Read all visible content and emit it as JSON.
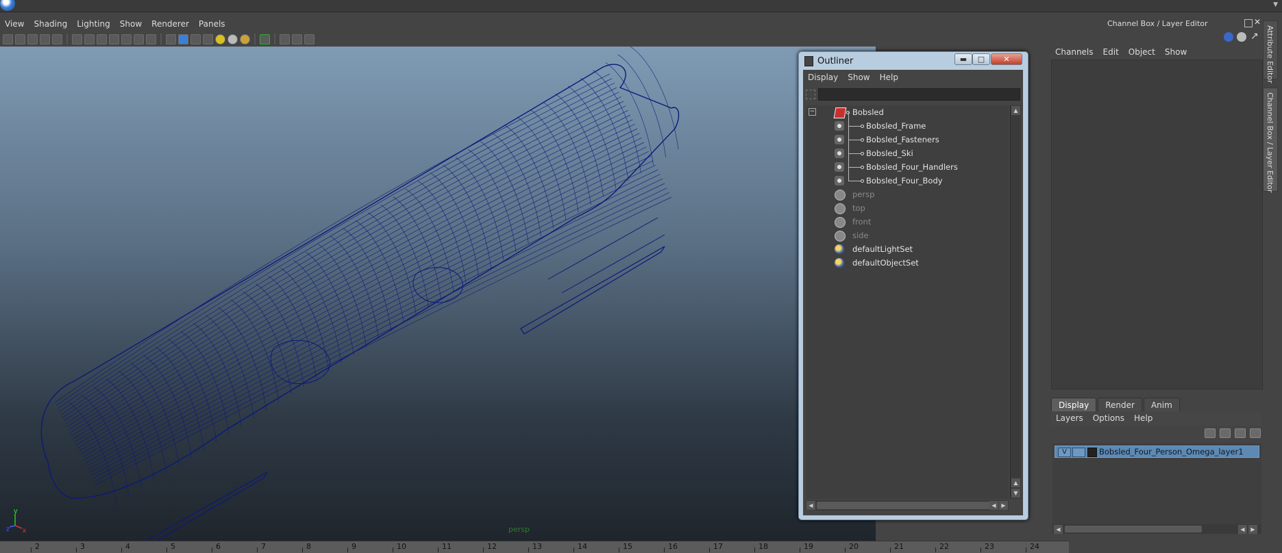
{
  "menubar": {
    "items": [
      "View",
      "Shading",
      "Lighting",
      "Show",
      "Renderer",
      "Panels"
    ]
  },
  "viewport": {
    "camera_label": "persp",
    "wireframe_color": "#0a1a7a",
    "axis": {
      "y": "y",
      "x": "x",
      "z": "z"
    }
  },
  "timeline": {
    "ticks": [
      "2",
      "3",
      "4",
      "5",
      "6",
      "7",
      "8",
      "9",
      "10",
      "11",
      "12",
      "13",
      "14",
      "15",
      "16",
      "17",
      "18",
      "19",
      "20",
      "21",
      "22",
      "23",
      "24"
    ]
  },
  "outliner": {
    "title": "Outliner",
    "buttons": {
      "minimize": "▬",
      "maximize": "□",
      "close": "✕"
    },
    "menu": [
      "Display",
      "Show",
      "Help"
    ],
    "filter_value": "",
    "tree": [
      {
        "label": "Bobsled",
        "kind": "group",
        "icon": "set-icon"
      },
      {
        "label": "Bobsled_Frame",
        "kind": "mesh",
        "icon": "mesh-icon"
      },
      {
        "label": "Bobsled_Fasteners",
        "kind": "mesh",
        "icon": "mesh-icon"
      },
      {
        "label": "Bobsled_Ski",
        "kind": "mesh",
        "icon": "mesh-icon"
      },
      {
        "label": "Bobsled_Four_Handlers",
        "kind": "mesh",
        "icon": "mesh-icon"
      },
      {
        "label": "Bobsled_Four_Body",
        "kind": "mesh",
        "icon": "mesh-icon"
      },
      {
        "label": "persp",
        "kind": "camera",
        "icon": "camera-icon"
      },
      {
        "label": "top",
        "kind": "camera",
        "icon": "camera-icon"
      },
      {
        "label": "front",
        "kind": "camera",
        "icon": "camera-icon"
      },
      {
        "label": "side",
        "kind": "camera",
        "icon": "camera-icon"
      },
      {
        "label": "defaultLightSet",
        "kind": "set",
        "icon": "light-set-icon"
      },
      {
        "label": "defaultObjectSet",
        "kind": "set",
        "icon": "object-set-icon"
      }
    ]
  },
  "channel_box": {
    "title": "Channel Box / Layer Editor",
    "menu": [
      "Channels",
      "Edit",
      "Object",
      "Show"
    ],
    "side_tabs": [
      "Attribute Editor",
      "Channel Box / Layer Editor"
    ]
  },
  "layer_editor": {
    "tabs": [
      "Display",
      "Render",
      "Anim"
    ],
    "active_tab": "Display",
    "menu": [
      "Layers",
      "Options",
      "Help"
    ],
    "layers": [
      {
        "visible": "V",
        "name": "Bobsled_Four_Person_Omega_layer1"
      }
    ]
  }
}
